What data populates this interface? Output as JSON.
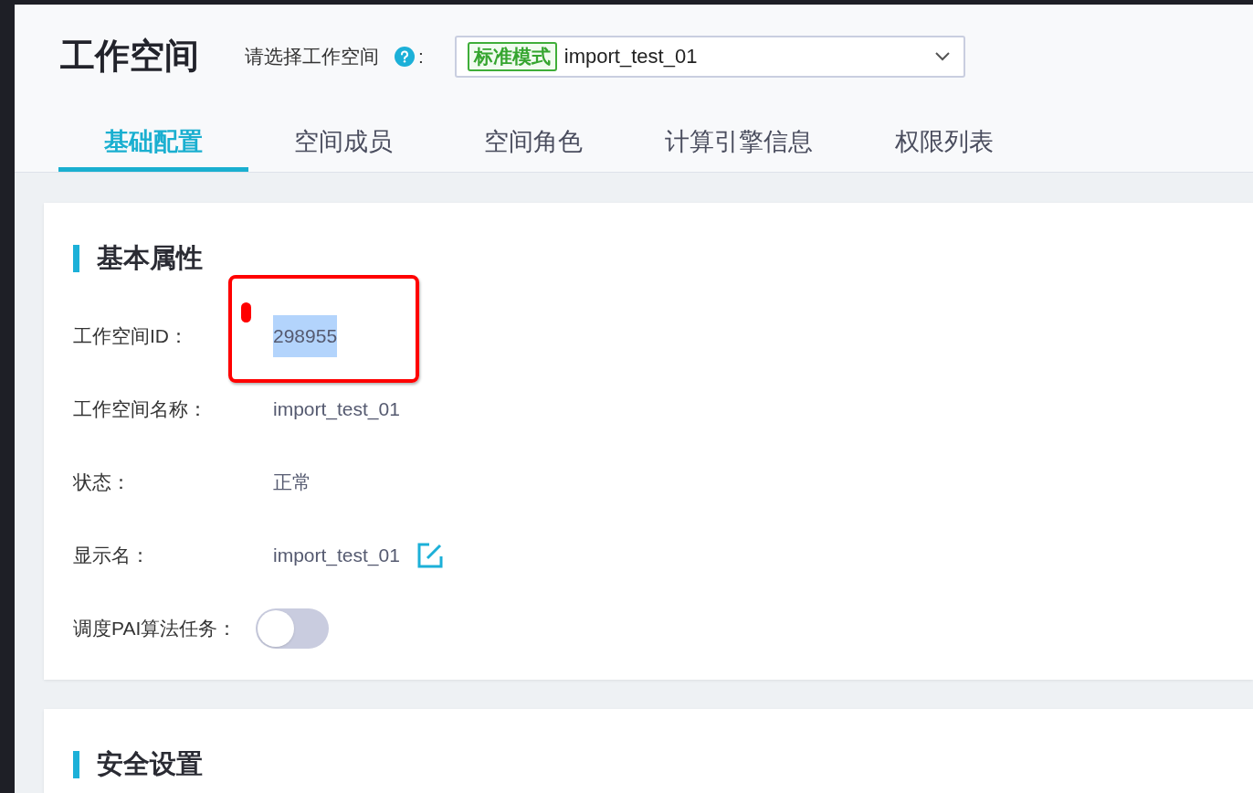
{
  "header": {
    "title": "工作空间",
    "selector_label": "请选择工作空间",
    "selector_colon": ":",
    "workspace_select": {
      "tag": "标准模式",
      "value": "import_test_01"
    }
  },
  "tabs": [
    {
      "label": "基础配置",
      "selected": true
    },
    {
      "label": "空间成员",
      "selected": false
    },
    {
      "label": "空间角色",
      "selected": false
    },
    {
      "label": "计算引擎信息",
      "selected": false
    },
    {
      "label": "权限列表",
      "selected": false
    }
  ],
  "sections": [
    {
      "title": "基本属性",
      "fields": [
        {
          "kind": "text",
          "label": "工作空间ID：",
          "value": "298955",
          "text_selected": true,
          "annotated": true
        },
        {
          "kind": "text",
          "label": "工作空间名称：",
          "value": "import_test_01",
          "text_selected": false,
          "annotated": false
        },
        {
          "kind": "text",
          "label": "状态：",
          "value": "正常",
          "text_selected": false,
          "annotated": false
        },
        {
          "kind": "editable",
          "label": "显示名：",
          "value": "import_test_01",
          "text_selected": false,
          "annotated": false
        },
        {
          "kind": "toggle",
          "label": "调度PAI算法任务：",
          "on": false
        }
      ]
    },
    {
      "title": "安全设置"
    }
  ]
}
